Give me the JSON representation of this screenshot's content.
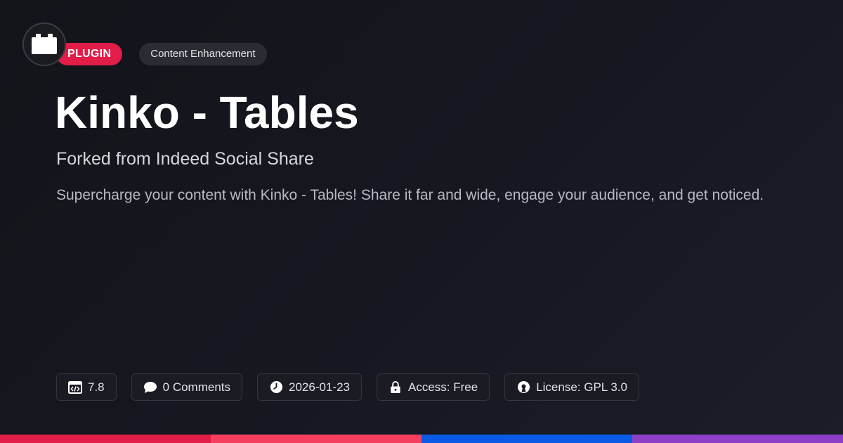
{
  "avatar": {
    "icon": "plugin-block-icon"
  },
  "badges": {
    "type": "PLUGIN",
    "category": "Content Enhancement",
    "type_color": "#e11d48"
  },
  "title": "Kinko - Tables",
  "subtitle": "Forked from Indeed Social Share",
  "description": "Supercharge your content with Kinko - Tables! Share it far and wide, engage your audience, and get noticed.",
  "meta": {
    "version": {
      "icon": "code-window-icon",
      "value": "7.8"
    },
    "comments": {
      "icon": "speech-bubble-icon",
      "value": "0 Comments"
    },
    "date": {
      "icon": "clock-icon",
      "value": "2026-01-23"
    },
    "access": {
      "icon": "lock-icon",
      "value": "Access: Free"
    },
    "license": {
      "icon": "open-source-icon",
      "value": "License: GPL 3.0"
    }
  },
  "bottom_bar": {
    "colors": [
      "#e11d48",
      "#f43f5e",
      "#0a5ae6",
      "#8e3fc8"
    ]
  }
}
